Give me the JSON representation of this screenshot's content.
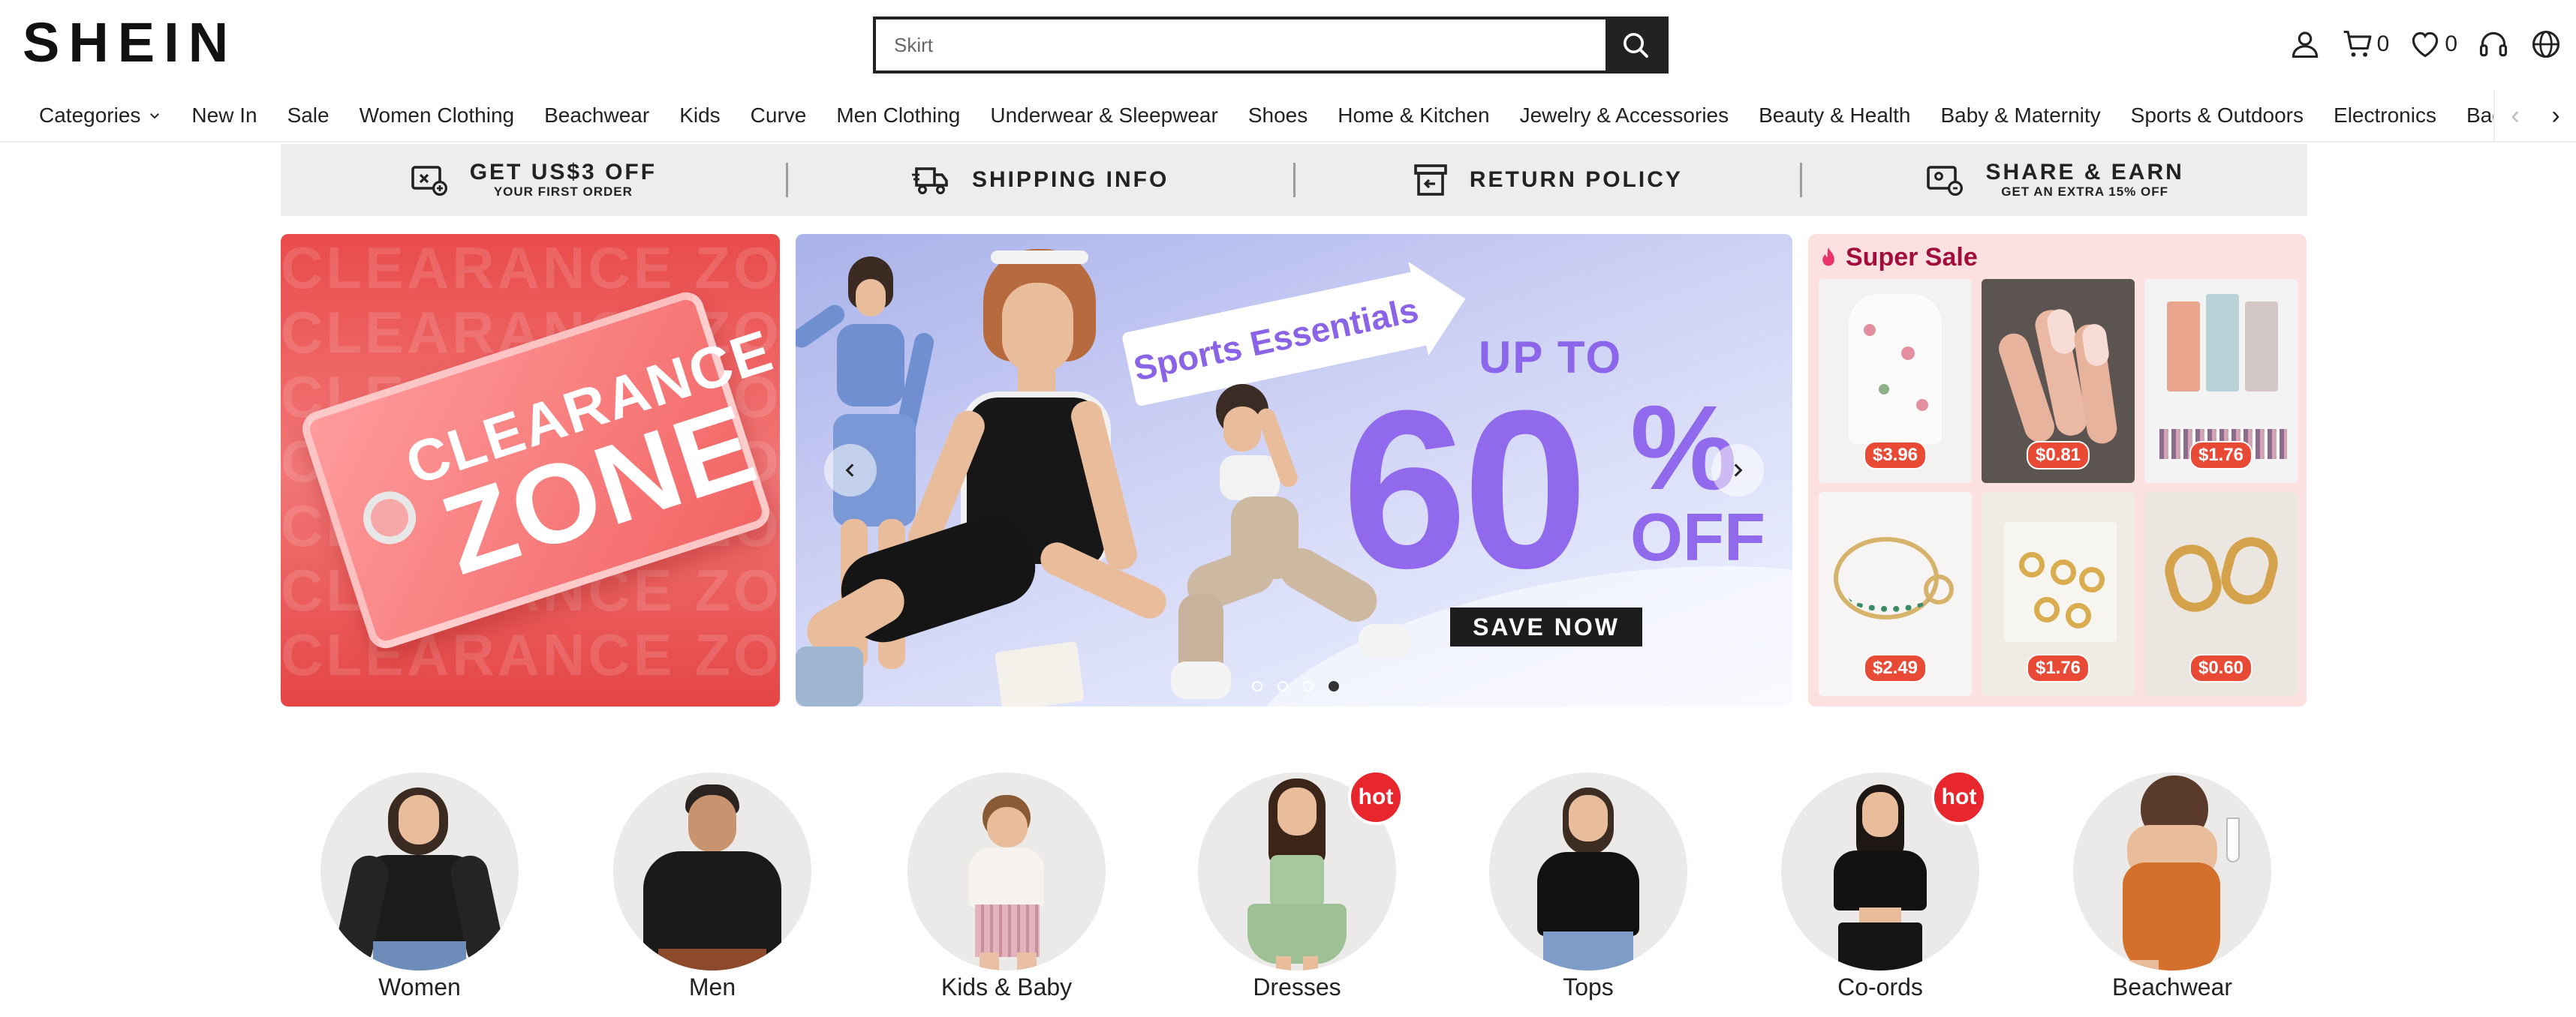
{
  "header": {
    "logo": "SHEIN",
    "search_placeholder": "Skirt",
    "cart_count": "0",
    "wishlist_count": "0"
  },
  "nav": {
    "categories_label": "Categories",
    "items": [
      "New In",
      "Sale",
      "Women Clothing",
      "Beachwear",
      "Kids",
      "Curve",
      "Men Clothing",
      "Underwear & Sleepwear",
      "Shoes",
      "Home & Kitchen",
      "Jewelry & Accessories",
      "Beauty & Health",
      "Baby & Maternity",
      "Sports & Outdoors",
      "Electronics",
      "Bags & Lu"
    ]
  },
  "benefits": [
    {
      "title": "GET US$3 OFF",
      "subtitle": "YOUR FIRST ORDER"
    },
    {
      "title": "SHIPPING INFO",
      "subtitle": ""
    },
    {
      "title": "RETURN POLICY",
      "subtitle": ""
    },
    {
      "title": "SHARE & EARN",
      "subtitle": "GET AN EXTRA 15% OFF"
    }
  ],
  "clearance": {
    "bg_text": "CLEARANCE ZONE",
    "line1": "CLEARANCE",
    "line2": "ZONE"
  },
  "hero": {
    "ribbon": "Sports Essentials",
    "up_to": "UP TO",
    "big_number": "60",
    "percent": "%",
    "off": "OFF",
    "cta": "SAVE NOW",
    "slide_count": 4,
    "active_slide": 4
  },
  "super_sale": {
    "title": "Super Sale",
    "products": [
      {
        "price": "$3.96"
      },
      {
        "price": "$0.81"
      },
      {
        "price": "$1.76"
      },
      {
        "price": "$2.49"
      },
      {
        "price": "$1.76"
      },
      {
        "price": "$0.60"
      }
    ]
  },
  "categories": [
    {
      "label": "Women",
      "hot": false
    },
    {
      "label": "Men",
      "hot": false
    },
    {
      "label": "Kids & Baby",
      "hot": false
    },
    {
      "label": "Dresses",
      "hot": true
    },
    {
      "label": "Tops",
      "hot": false
    },
    {
      "label": "Co-ords",
      "hot": true
    },
    {
      "label": "Beachwear",
      "hot": false
    }
  ],
  "hot_badge": "hot",
  "colors": {
    "accent_purple": "#9169ec",
    "super_sale_red": "#a30d3d",
    "price_tag": "#e94a36",
    "hot_badge": "#e8262d"
  }
}
